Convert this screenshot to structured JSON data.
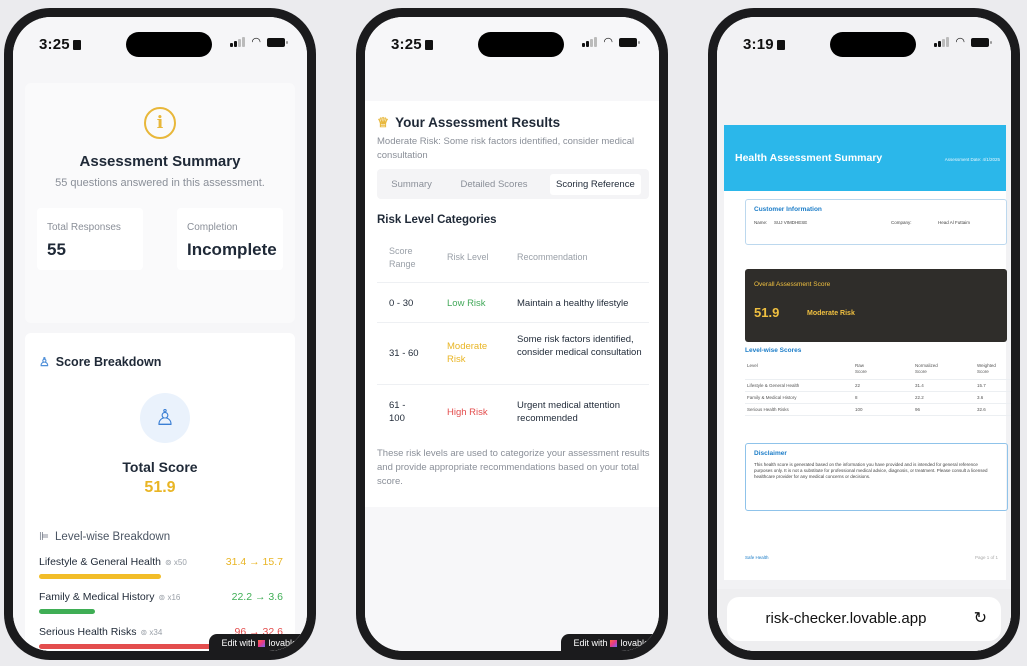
{
  "phones": [
    {
      "time": "3:25"
    },
    {
      "time": "3:25"
    },
    {
      "time": "3:19"
    }
  ],
  "badge": {
    "prefix": "Edit with",
    "brand": "lovable"
  },
  "summary": {
    "info_icon": "i",
    "title": "Assessment Summary",
    "subtitle": "55 questions answered in this assessment.",
    "stats": [
      {
        "label": "Total Responses",
        "value": "55"
      },
      {
        "label": "Completion",
        "value": "Incomplete"
      }
    ]
  },
  "breakdown": {
    "icon": "award-icon",
    "title": "Score Breakdown",
    "total_label": "Total Score",
    "total_value": "51.9",
    "level_title": "Level-wise Breakdown",
    "levels": [
      {
        "name": "Lifestyle & General Health",
        "questions": "x50",
        "score": "31.4 → 15.7",
        "fill_pct": 50,
        "color": "#f2bd28"
      },
      {
        "name": "Family & Medical History",
        "questions": "x16",
        "score": "22.2 → 3.6",
        "fill_pct": 23,
        "color": "#3fae55"
      },
      {
        "name": "Serious Health Risks",
        "questions": "x34",
        "score": "96 → 32.6",
        "fill_pct": 98,
        "color": "#e34d4d"
      }
    ]
  },
  "results": {
    "title": "Your Assessment Results",
    "subtitle": "Moderate Risk: Some risk factors identified, consider medical consultation",
    "tabs": [
      "Summary",
      "Detailed Scores",
      "Scoring Reference"
    ],
    "active_tab": 2,
    "categories_title": "Risk Level Categories",
    "headers": [
      "Score Range",
      "Risk Level",
      "Recommendation"
    ],
    "rows": [
      {
        "range": "0 - 30",
        "level": "Low Risk",
        "color": "#43a85a",
        "rec": "Maintain a healthy lifestyle"
      },
      {
        "range": "31 - 60",
        "level": "Moderate Risk",
        "color": "#e9b524",
        "rec": "Some risk factors identified, consider medical consultation"
      },
      {
        "range": "61 - 100",
        "level": "High Risk",
        "color": "#e34d4d",
        "rec": "Urgent medical attention recommended"
      }
    ],
    "footnote": "These risk levels are used to categorize your assessment results and provide appropriate recommendations based on your total score."
  },
  "report": {
    "title": "Health Assessment Summary",
    "date": "Assessment Date: 4/1/2025",
    "customer_title": "Customer Information",
    "name_label": "Name:",
    "name_value": "SUJ VIMDHESE",
    "company_label": "Company:",
    "company_value": "Head Al Futtaim",
    "overall_title": "Overall Assessment Score",
    "overall_value": "51.9",
    "overall_risk": "Moderate Risk",
    "lw_title": "Level-wise Scores",
    "lw_headers": [
      "Level",
      "Raw Score",
      "Normalized Score",
      "Weighted Score"
    ],
    "lw_rows": [
      [
        "Lifestyle & General Health",
        "22",
        "31.4",
        "15.7"
      ],
      [
        "Family & Medical History",
        "8",
        "22.2",
        "3.6"
      ],
      [
        "Serious Health Risks",
        "100",
        "96",
        "32.6"
      ]
    ],
    "disclaimer_title": "Disclaimer",
    "disclaimer_text": "This health score is generated based on the information you have provided and is intended for general reference purposes only. It is not a substitute for professional medical advice, diagnosis, or treatment. Please consult a licensed healthcare provider for any medical concerns or decisions.",
    "footer_left": "Safe Health",
    "footer_right": "Page 1 of 1",
    "url": "risk-checker.lovable.app"
  }
}
